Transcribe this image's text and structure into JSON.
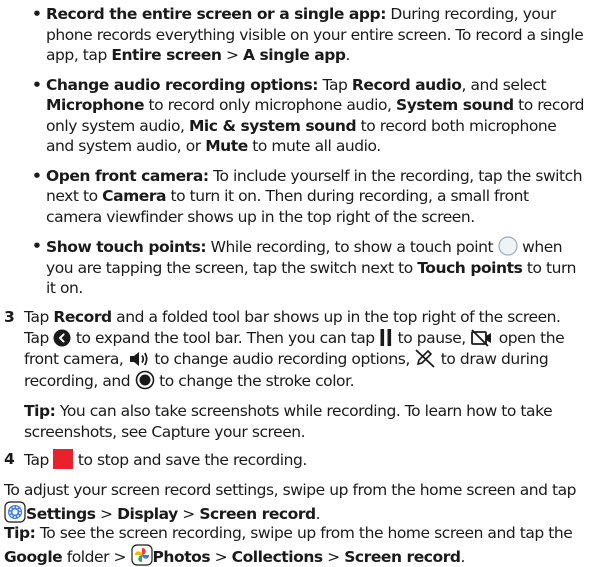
{
  "bullets": [
    {
      "title": "Record the entire screen or a single app:",
      "t1": " During recording, your phone records everything visible on your entire screen. To record a single app, tap ",
      "b1": "Entire screen",
      "t2": " > ",
      "b2": "A single app",
      "t3": "."
    },
    {
      "title": "Change audio recording options:",
      "t1": " Tap ",
      "b1": "Record audio",
      "t2": ", and select ",
      "b2": "Microphone",
      "t3": " to record only microphone audio, ",
      "b3": "System sound",
      "t4": " to record only system audio, ",
      "b4": "Mic & system sound",
      "t5": " to record both microphone and system audio, or ",
      "b5": "Mute",
      "t6": " to mute all audio."
    },
    {
      "title": "Open front camera:",
      "t1": " To include yourself in the recording, tap the switch next to ",
      "b1": "Camera",
      "t2": " to turn it on. Then during recording, a small front camera viewfinder shows up in the top right of the screen."
    },
    {
      "title": "Show touch points:",
      "t1": " While recording, to show a touch point ",
      "t2": " when you are tapping the screen, tap the switch next to ",
      "b1": "Touch points",
      "t3": " to turn it on."
    }
  ],
  "step3": {
    "num": "3",
    "t1": "Tap ",
    "b1": "Record",
    "t2": " and a folded tool bar shows up in the top right of the screen. Tap ",
    "t3": " to expand the tool bar. Then you can tap ",
    "t4": " to pause, ",
    "t5": " open the front camera, ",
    "t6": " to change audio recording options, ",
    "t7": " to draw during recording, and ",
    "t8": " to change the stroke color.",
    "tip_label": "Tip:",
    "tip_text": " You can also take screenshots while recording. To learn how to take screenshots, see Capture your screen."
  },
  "step4": {
    "num": "4",
    "t1": "Tap ",
    "t2": " to stop and save the recording."
  },
  "adjust": {
    "t1": "To adjust your screen record settings, swipe up from the home screen and tap ",
    "b1": "Settings",
    "t2": " > ",
    "b2": "Display",
    "t3": " > ",
    "b3": "Screen record",
    "t4": "."
  },
  "tip2": {
    "label": "Tip:",
    "t1": " To see the screen recording, swipe up from the home screen and tap the ",
    "b1": "Google",
    "t2": " folder > ",
    "b2": "Photos",
    "t3": " > ",
    "b3": "Collections",
    "t4": " > ",
    "b4": "Screen record",
    "t5": "."
  },
  "colors": {
    "text": "#1a1a1a",
    "stop": "#e8222a",
    "settings": "#3d7be0",
    "touch": "#9aa9bb"
  },
  "icons": [
    "touch-point-icon",
    "expand-chevron-icon",
    "pause-icon",
    "camera-off-icon",
    "speaker-icon",
    "pen-off-icon",
    "stroke-color-icon",
    "stop-square-icon",
    "settings-app-icon",
    "photos-app-icon"
  ]
}
